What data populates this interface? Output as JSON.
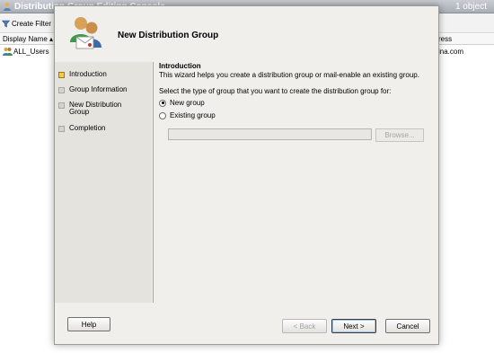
{
  "console": {
    "title": "Distribution Group Editing Console",
    "object_count": "1 object",
    "toolbar": {
      "create_filter_label": "Create Filter"
    },
    "columns": {
      "display_name": "Display Name",
      "address": "ress"
    },
    "rows": [
      {
        "display_name": "ALL_Users",
        "address": "ina.com"
      }
    ]
  },
  "wizard": {
    "title": "New Distribution Group",
    "nav": [
      {
        "label": "Introduction",
        "active": true
      },
      {
        "label": "Group Information",
        "active": false
      },
      {
        "label": "New Distribution Group",
        "active": false
      },
      {
        "label": "Completion",
        "active": false
      }
    ],
    "content": {
      "heading": "Introduction",
      "description": "This wizard helps you create a distribution group or mail-enable an existing group.",
      "prompt": "Select the type of group that you want to create the distribution group for:",
      "options": [
        {
          "label": "New group",
          "selected": true
        },
        {
          "label": "Existing group",
          "selected": false
        }
      ],
      "existing_group_value": "",
      "browse_label": "Browse..."
    },
    "buttons": {
      "help": "Help",
      "back": "< Back",
      "next": "Next >",
      "cancel": "Cancel"
    }
  }
}
